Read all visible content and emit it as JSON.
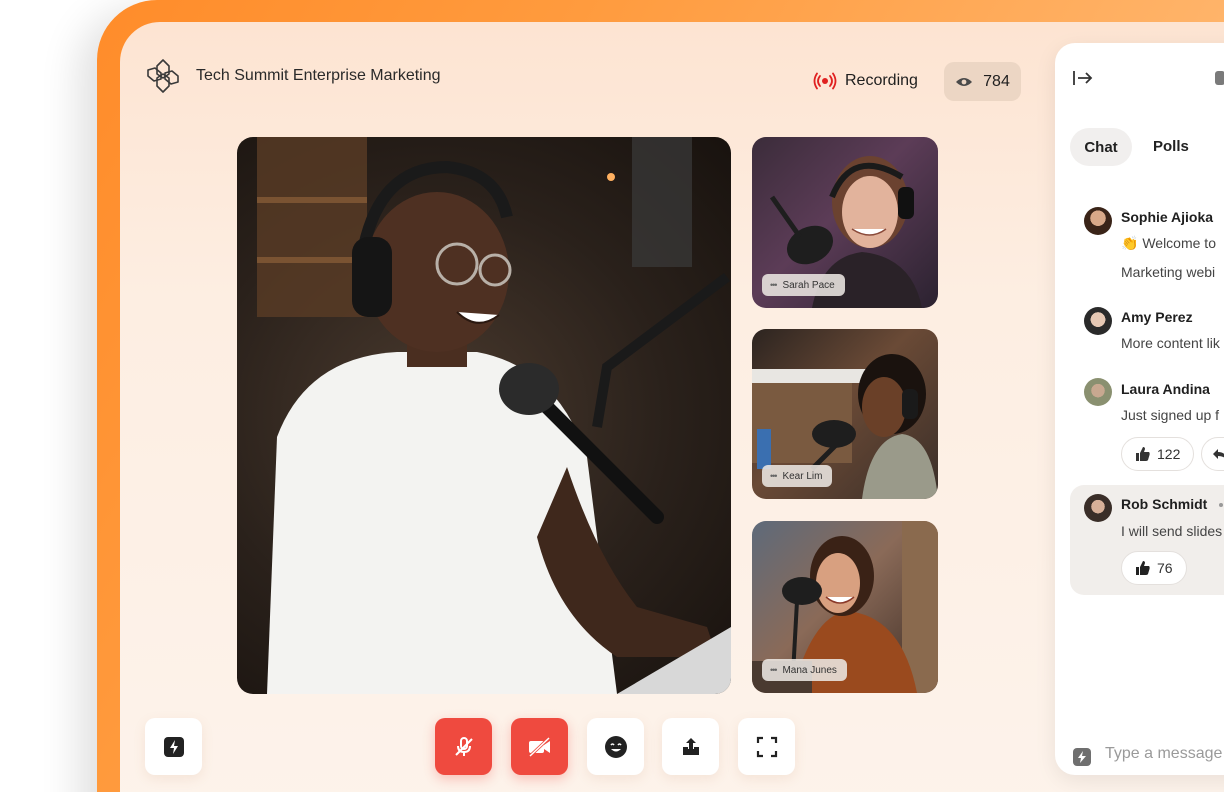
{
  "header": {
    "title": "Tech Summit Enterprise Marketing",
    "recording_label": "Recording",
    "viewer_count": "784"
  },
  "participants": [
    {
      "name": "Sarah Pace"
    },
    {
      "name": "Kear Lim"
    },
    {
      "name": "Mana Junes"
    }
  ],
  "controls": {
    "icons": [
      "bolt-icon",
      "mic-off-icon",
      "camera-off-icon",
      "emoji-icon",
      "share-icon",
      "fullscreen-icon"
    ],
    "accent_red": "#ef4a3f"
  },
  "chat": {
    "tabs": [
      "Chat",
      "Polls"
    ],
    "messages": [
      {
        "name": "Sophie Ajioka",
        "line1": "👏 Welcome to",
        "line2": "Marketing webi"
      },
      {
        "name": "Amy Perez",
        "line1": "More content lik"
      },
      {
        "name": "Laura Andina",
        "line1": "Just signed up f",
        "reaction": "122"
      },
      {
        "name": "Rob Schmidt",
        "line1": "I will send slides",
        "reaction": "76"
      }
    ],
    "input_placeholder": "Type a message"
  },
  "colors": {
    "frame_orange": "#ff8c2a",
    "background_cream": "#fdeee2",
    "viewer_badge": "#ecd6c4"
  }
}
